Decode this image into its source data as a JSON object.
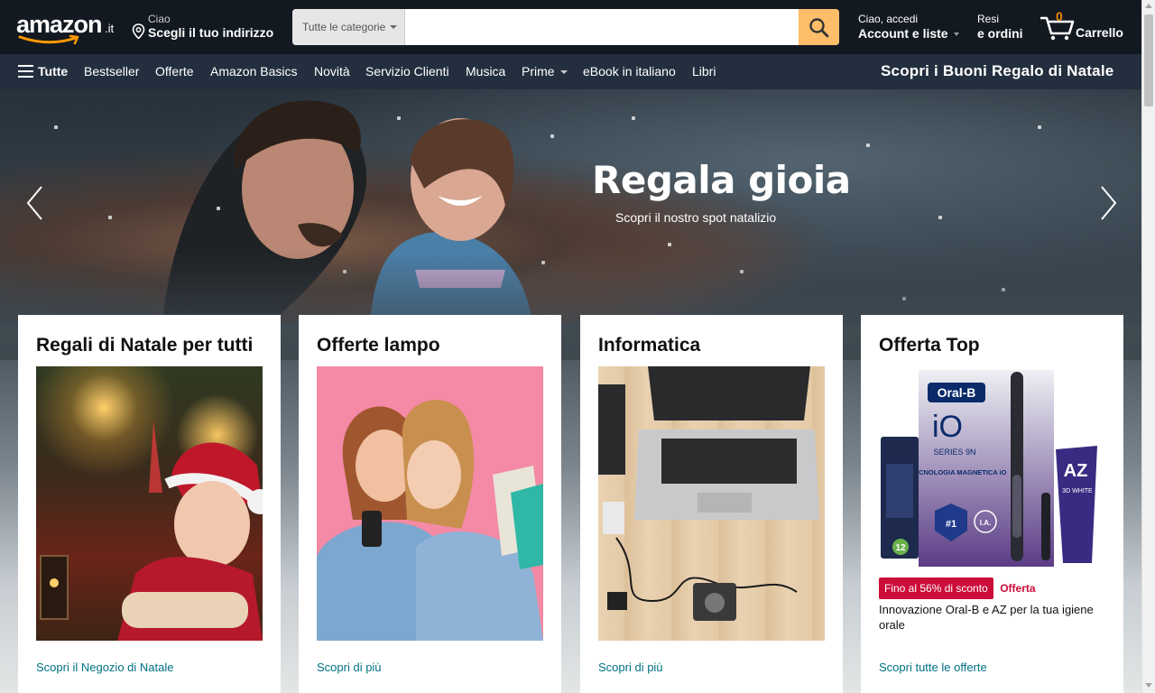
{
  "header": {
    "logo_word": "amazon",
    "logo_tld": ".it",
    "deliver_hello": "Ciao",
    "deliver_address": "Scegli il tuo indirizzo",
    "search_category": "Tutte le categorie",
    "search_placeholder": "",
    "account_hello": "Ciao, accedi",
    "account_label": "Account e liste",
    "orders_l1": "Resi",
    "orders_l2": "e ordini",
    "cart_count": "0",
    "cart_label": "Carrello"
  },
  "subnav": {
    "all_label": "Tutte",
    "items": [
      "Bestseller",
      "Offerte",
      "Amazon Basics",
      "Novità",
      "Servizio Clienti",
      "Musica",
      "Prime",
      "eBook in italiano",
      "Libri"
    ],
    "promo": "Scopri i Buoni Regalo di Natale"
  },
  "hero": {
    "title": "Regala gioia",
    "subtitle": "Scopri il nostro spot natalizio"
  },
  "cards": [
    {
      "title": "Regali di Natale per tutti",
      "link": "Scopri il Negozio di Natale"
    },
    {
      "title": "Offerte lampo",
      "link": "Scopri di più"
    },
    {
      "title": "Informatica",
      "link": "Scopri di più"
    },
    {
      "title": "Offerta Top",
      "badge": "Fino al 56% di sconto",
      "deal_label": "Offerta",
      "description": "Innovazione Oral-B e AZ per la tua igiene orale",
      "link": "Scopri tutte le offerte",
      "product_texts": {
        "brand": "Oral-B",
        "model": "iO",
        "series": "SERIES 9N",
        "tech": "TECNOLOGIA MAGNETICA iO",
        "heads": "12",
        "rank": "#1",
        "ia": "I.A.",
        "az": "AZ",
        "az_sub": "3D WHITE"
      }
    }
  ],
  "colors": {
    "header_bg": "#131921",
    "subnav_bg": "#232f3e",
    "search_button": "#febd69",
    "link": "#007185",
    "deal_badge": "#cc0c39"
  }
}
